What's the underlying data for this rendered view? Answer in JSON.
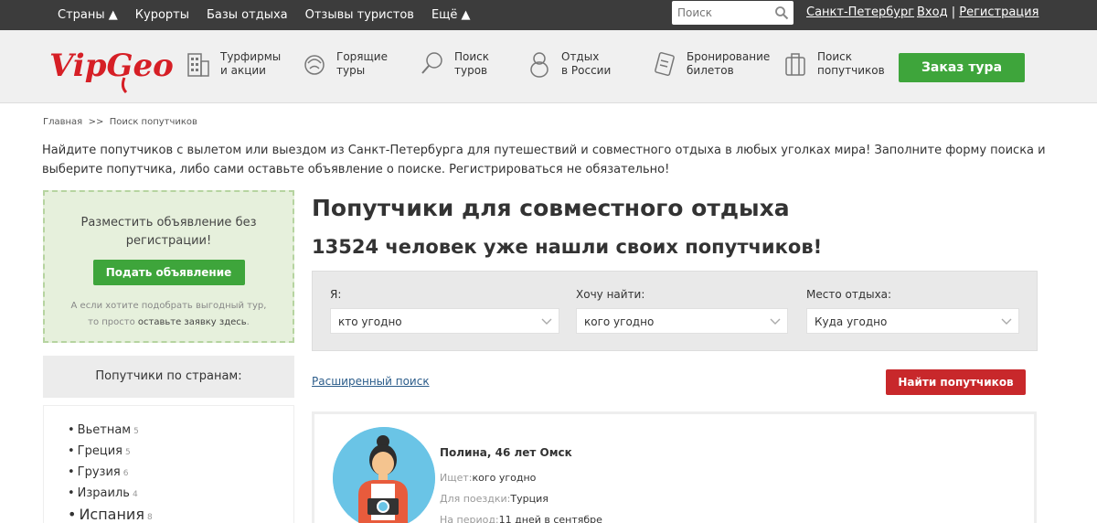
{
  "topnav": {
    "items": [
      "Страны ▲",
      "Курорты",
      "Базы отдыха",
      "Отзывы туристов",
      "Ещё ▲"
    ],
    "search_placeholder": "Поиск",
    "city": "Санкт-Петербург",
    "login": "Вход",
    "separator": "|",
    "register": "Регистрация"
  },
  "header": {
    "logo_text": "VipGeo",
    "nav": [
      {
        "line1": "Турфирмы",
        "line2": "и акции",
        "icon": "building-icon"
      },
      {
        "line1": "Горящие",
        "line2": "туры",
        "icon": "fire-tour-icon"
      },
      {
        "line1": "Поиск",
        "line2": "туров",
        "icon": "magnifier-icon"
      },
      {
        "line1": "Отдых",
        "line2": "в России",
        "icon": "matryoshka-icon"
      },
      {
        "line1": "Бронирование",
        "line2": "билетов",
        "icon": "tickets-icon"
      },
      {
        "line1": "Поиск",
        "line2": "попутчиков",
        "icon": "luggage-icon"
      }
    ],
    "order_button": "Заказ тура",
    "brand_green": "#3ea53b",
    "brand_red": "#c8282b"
  },
  "breadcrumb": {
    "home": "Главная",
    "sep": ">>",
    "current": "Поиск попутчиков"
  },
  "intro": "Найдите попутчиков с вылетом или выездом из Санкт-Петербурга для путешествий и совместного отдыха в любых уголках мира! Заполните форму поиска и выберите попутчика, либо сами оставьте объявление о поиске. Регистрироваться не обязательно!",
  "postbox": {
    "text": "Разместить объявление без регистрации!",
    "button": "Подать объявление",
    "sub_line1": "А если хотите подобрать выгодный тур,",
    "sub_line2_prefix": "то просто ",
    "sub_link": "оставьте заявку здесь",
    "sub_suffix": "."
  },
  "countries": {
    "title": "Попутчики по странам:",
    "items": [
      {
        "name": "Вьетнам",
        "count": "5"
      },
      {
        "name": "Греция",
        "count": "5"
      },
      {
        "name": "Грузия",
        "count": "6"
      },
      {
        "name": "Израиль",
        "count": "4"
      },
      {
        "name": "Испания",
        "count": "8"
      }
    ]
  },
  "main": {
    "title": "Попутчики для совместного отдыха",
    "subtitle": "13524 человек уже нашли своих попутчиков!",
    "filters": [
      {
        "label": "Я:",
        "value": "кто угодно"
      },
      {
        "label": "Хочу найти:",
        "value": "кого угодно"
      },
      {
        "label": "Место отдыха:",
        "value": "Куда угодно"
      }
    ],
    "advanced_link": "Расширенный поиск",
    "find_button": "Найти попутчиков"
  },
  "card": {
    "name": "Полина, 46 лет Омск",
    "rows": [
      {
        "label": "Ищет:",
        "value": "кого угодно"
      },
      {
        "label": "Для поездки:",
        "value": "Турция"
      },
      {
        "label": "На период:",
        "value": "11 дней в сентябре"
      }
    ]
  }
}
